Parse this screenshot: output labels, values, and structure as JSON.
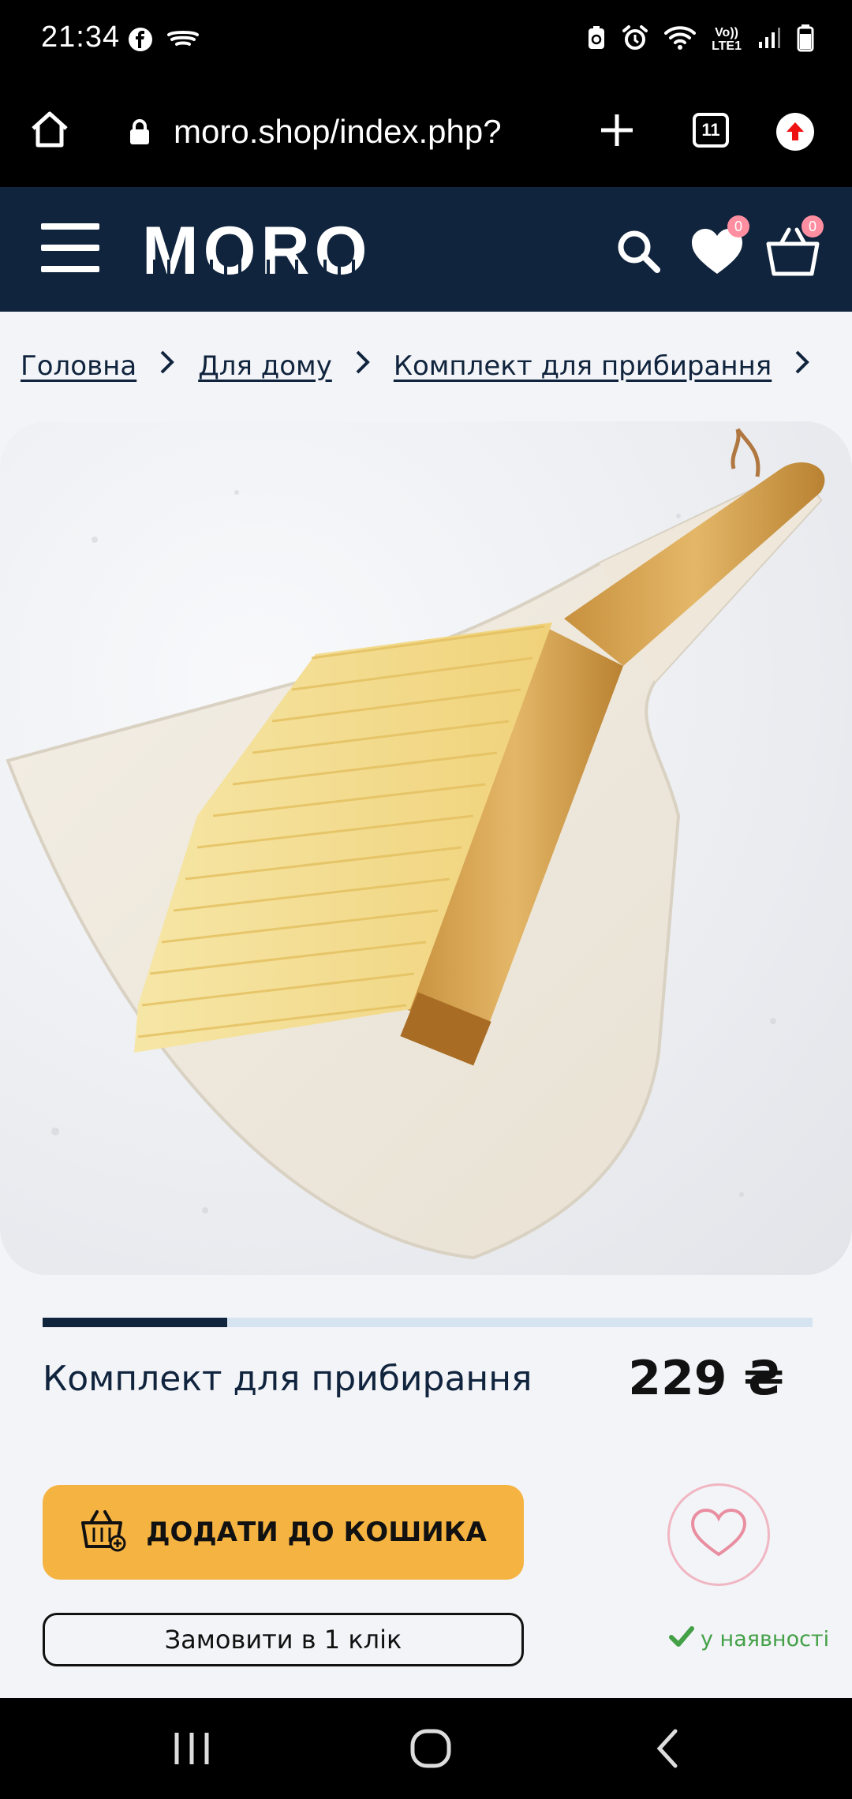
{
  "status_bar": {
    "time": "21:34",
    "network_line1": "Vo))",
    "network_line2": "LTE1",
    "icons": [
      "facebook-icon",
      "cast-icon",
      "battery-saver-icon",
      "alarm-icon",
      "wifi-icon",
      "signal-icon",
      "battery-icon"
    ]
  },
  "browser": {
    "url": "moro.shop/index.php?",
    "tab_count": "11"
  },
  "header": {
    "logo": "MORO",
    "wishlist_count": "0",
    "cart_count": "0",
    "brand_color": "#10243d"
  },
  "breadcrumb": {
    "items": [
      "Головна",
      "Для дому",
      "Комплект для прибирання"
    ]
  },
  "product": {
    "title": "Комплект для прибирання",
    "price": "229 ₴",
    "gallery_progress": 0.24,
    "add_to_cart_label": "ДОДАТИ ДО КОШИКА",
    "one_click_label": "Замовити в 1 клік",
    "stock_status": "у наявності",
    "accent_color": "#f5b342",
    "stock_color": "#43a047"
  }
}
